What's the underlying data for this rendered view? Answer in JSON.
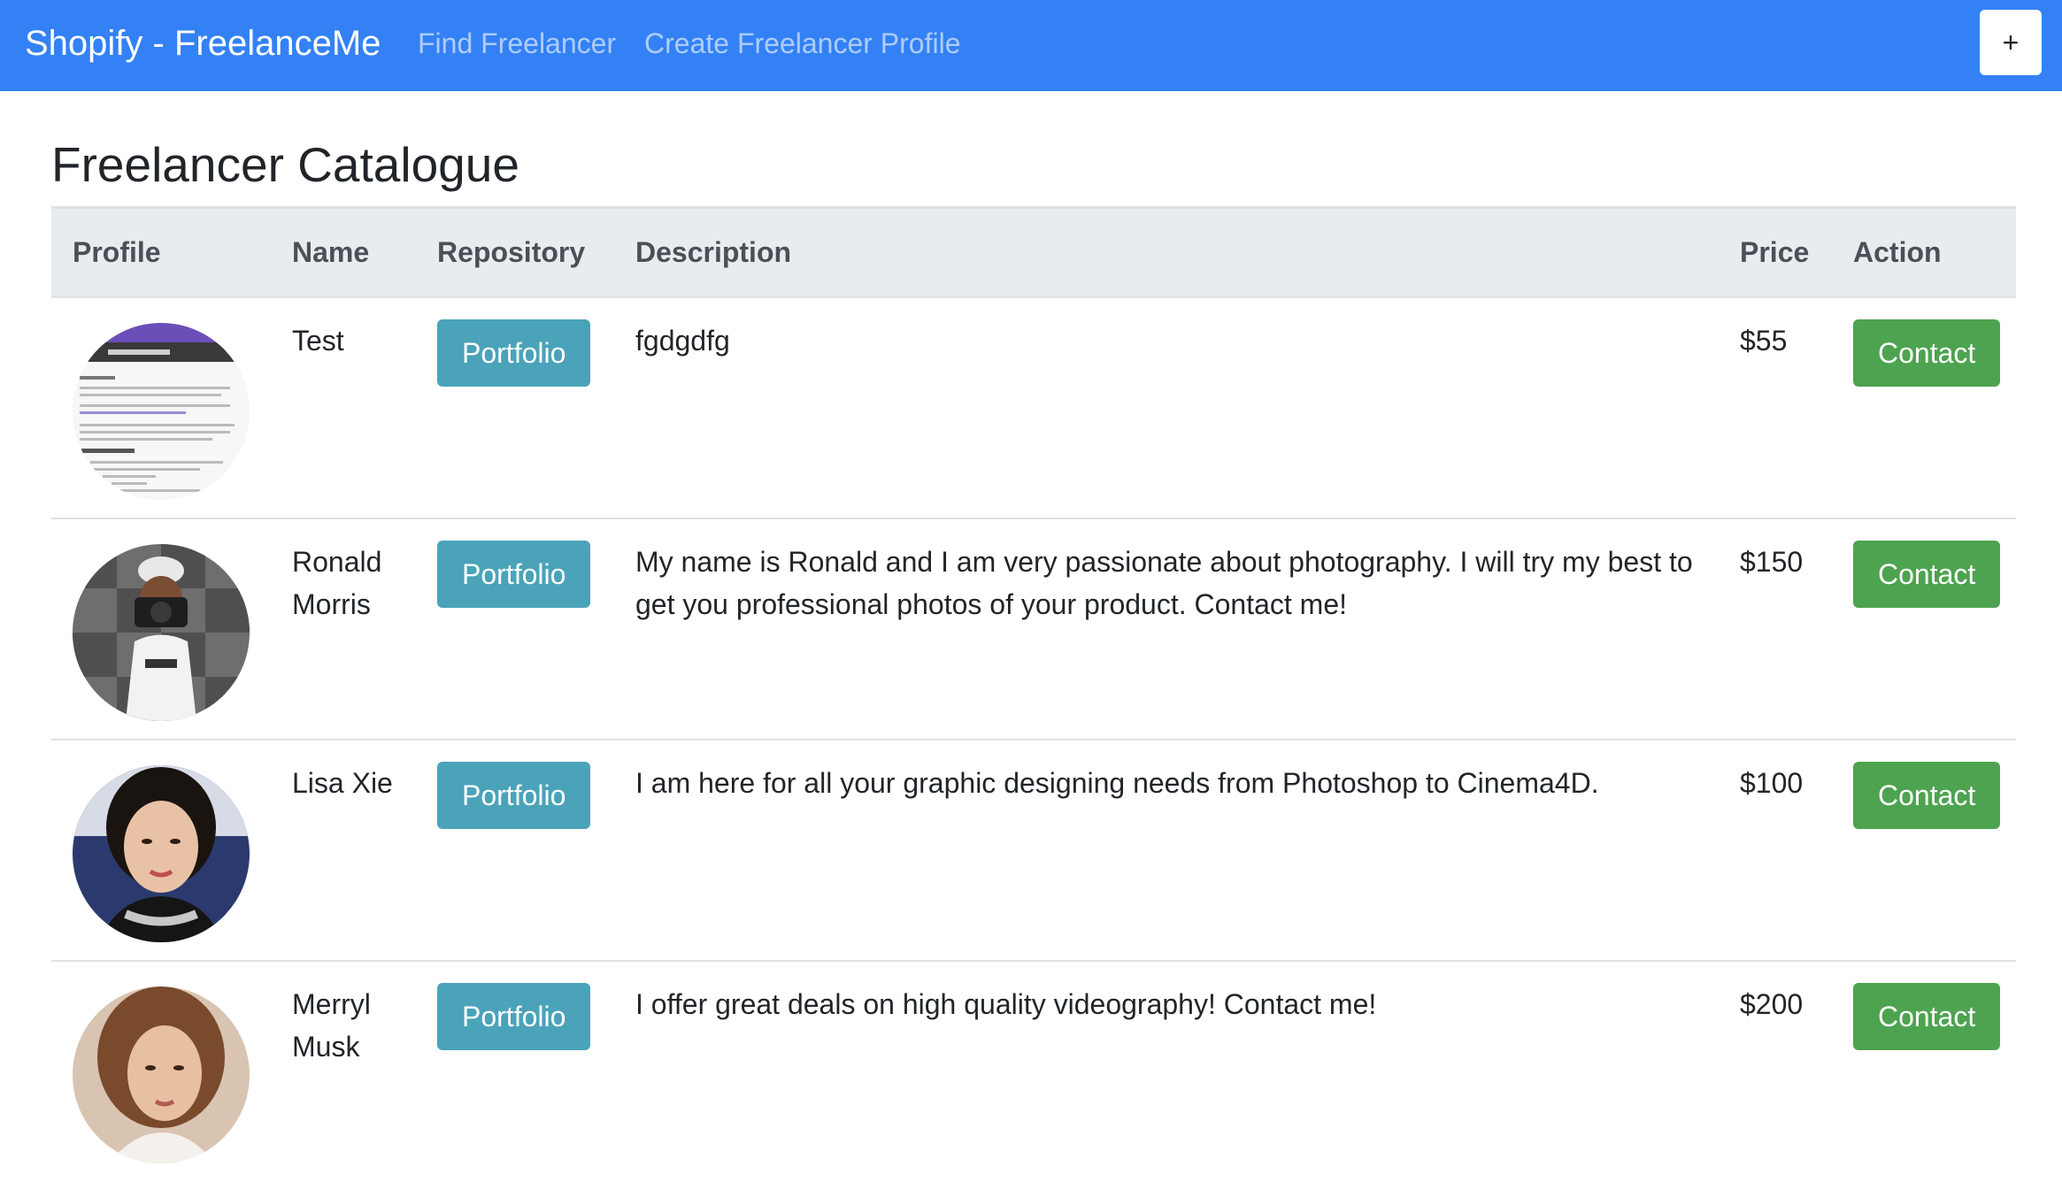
{
  "navbar": {
    "brand": "Shopify - FreelanceMe",
    "links": [
      {
        "label": "Find Freelancer"
      },
      {
        "label": "Create Freelancer Profile"
      }
    ],
    "toggle_label": "+"
  },
  "page": {
    "title": "Freelancer Catalogue"
  },
  "table": {
    "headers": [
      "Profile",
      "Name",
      "Repository",
      "Description",
      "Price",
      "Action"
    ],
    "rows": [
      {
        "name": "Test",
        "repository_label": "Portfolio",
        "description": "fgdgdfg",
        "price": "$55",
        "action_label": "Contact",
        "avatar": "document-screenshot-avatar"
      },
      {
        "name": "Ronald Morris",
        "repository_label": "Portfolio",
        "description": "My name is Ronald and I am very passionate about photography. I will try my best to get you professional photos of your product. Contact me!",
        "price": "$150",
        "action_label": "Contact",
        "avatar": "photographer-avatar"
      },
      {
        "name": "Lisa Xie",
        "repository_label": "Portfolio",
        "description": "I am here for all your graphic designing needs from Photoshop to Cinema4D.",
        "price": "$100",
        "action_label": "Contact",
        "avatar": "woman-portrait-avatar"
      },
      {
        "name": "Merryl Musk",
        "repository_label": "Portfolio",
        "description": "I offer great deals on high quality videography! Contact me!",
        "price": "$200",
        "action_label": "Contact",
        "avatar": "woman-portrait-avatar"
      }
    ]
  },
  "colors": {
    "navbar_bg": "#3381f5",
    "portfolio_button": "#4aa3b9",
    "contact_button": "#4da34f",
    "table_header_bg": "#e9ecef"
  }
}
